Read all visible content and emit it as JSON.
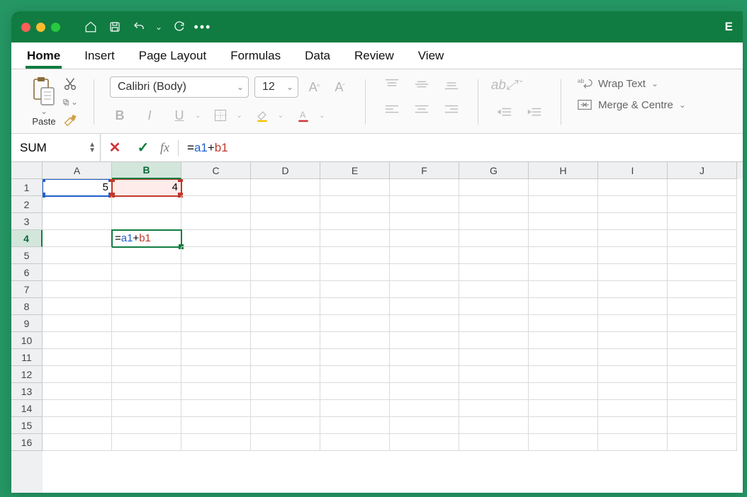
{
  "titlebar": {
    "app_initial": "E"
  },
  "tabs": [
    "Home",
    "Insert",
    "Page Layout",
    "Formulas",
    "Data",
    "Review",
    "View"
  ],
  "active_tab": 0,
  "clipboard": {
    "paste_label": "Paste"
  },
  "font": {
    "name": "Calibri (Body)",
    "size": "12",
    "bold": "B",
    "italic": "I",
    "underline": "U"
  },
  "wrap": {
    "wrap_text": "Wrap Text",
    "merge_centre": "Merge & Centre"
  },
  "formula_bar": {
    "name_box": "SUM",
    "fx_label": "fx",
    "formula_prefix": "=",
    "ref1": "a1",
    "operator": "+",
    "ref2": "b1"
  },
  "columns": [
    "A",
    "B",
    "C",
    "D",
    "E",
    "F",
    "G",
    "H",
    "I",
    "J"
  ],
  "row_count": 16,
  "selected_col_index": 1,
  "selected_row_index": 3,
  "cell_values": {
    "A1": "5",
    "B1": "4",
    "B4_display": "=a1+b1",
    "B4_ref1": "a1",
    "B4_op": "+",
    "B4_ref2": "b1"
  },
  "reference_highlight": {
    "A1": "blue",
    "B1": "red"
  },
  "active_cell": "B4"
}
